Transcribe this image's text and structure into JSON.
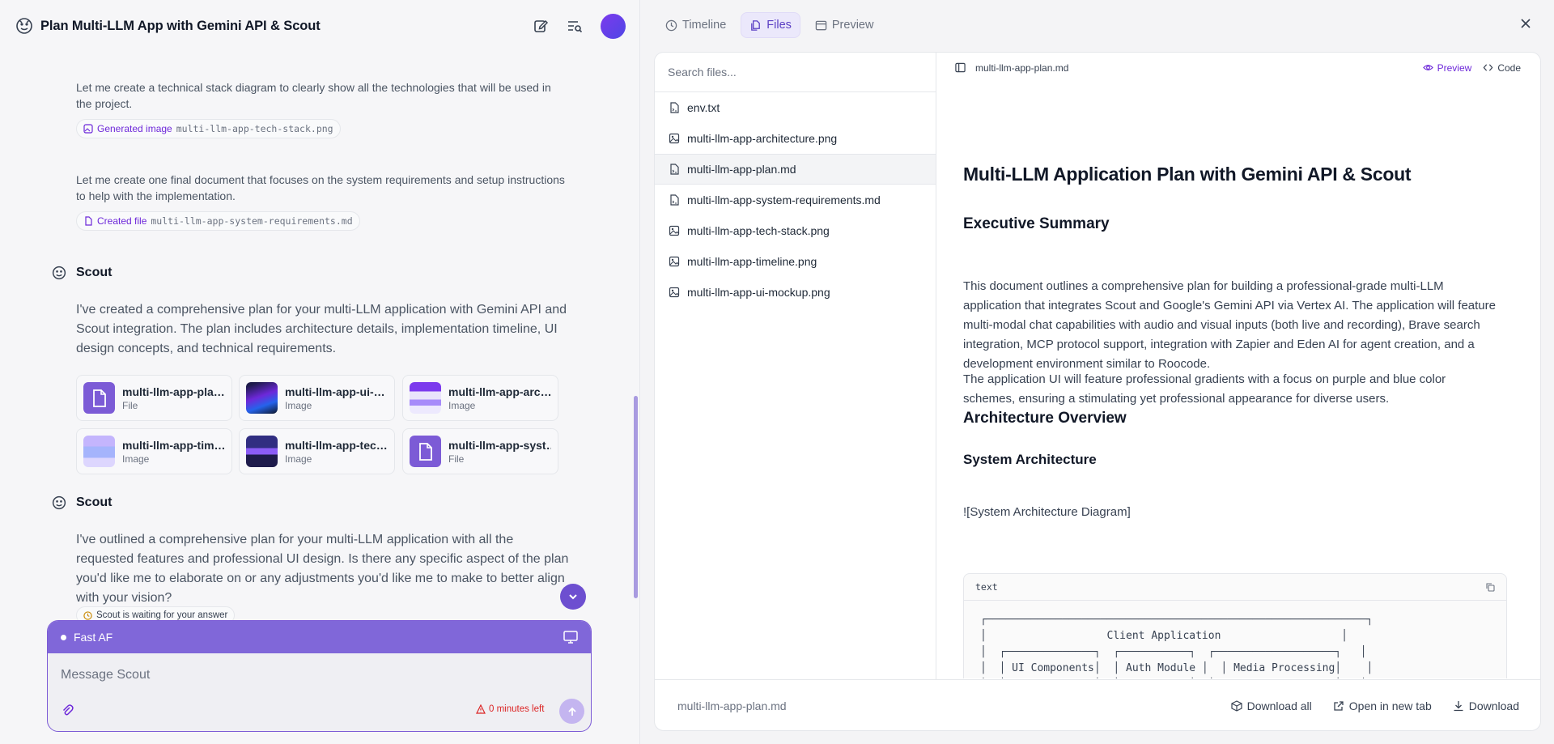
{
  "header": {
    "title": "Plan Multi-LLM App with Gemini API & Scout"
  },
  "chat": {
    "step1_text": "Let me create a technical stack diagram to clearly show all the technologies that will be used in the project.",
    "step1_chip_label": "Generated image",
    "step1_chip_file": "multi-llm-app-tech-stack.png",
    "step2_text": "Let me create one final document that focuses on the system requirements and setup instructions to help with the implementation.",
    "step2_chip_label": "Created file",
    "step2_chip_file": "multi-llm-app-system-requirements.md",
    "speaker1": "Scout",
    "msg1": "I've created a comprehensive plan for your multi-LLM application with Gemini API and Scout integration. The plan includes architecture details, implementation timeline, UI design concepts, and technical requirements.",
    "attachments": [
      {
        "name": "multi-llm-app-plan.md",
        "type": "File",
        "thumb": "file"
      },
      {
        "name": "multi-llm-app-ui-mockup.png",
        "type": "Image",
        "thumb": "img-a"
      },
      {
        "name": "multi-llm-app-architecture.png",
        "type": "Image",
        "thumb": "img-b"
      },
      {
        "name": "multi-llm-app-timeline.png",
        "type": "Image",
        "thumb": "img-c"
      },
      {
        "name": "multi-llm-app-tech-stack.png",
        "type": "Image",
        "thumb": "img-d"
      },
      {
        "name": "multi-llm-app-system-requirements.md",
        "type": "File",
        "thumb": "file"
      }
    ],
    "speaker2": "Scout",
    "msg2": "I've outlined a comprehensive plan for your multi-LLM application with all the requested features and professional UI design. Is there any specific aspect of the plan you'd like me to elaborate on or any adjustments you'd like me to make to better align with your vision?",
    "waiting": "Scout is waiting for your answer"
  },
  "composer": {
    "mode": "Fast AF",
    "placeholder": "Message Scout",
    "timer": "0 minutes left"
  },
  "tabs": [
    {
      "label": "Timeline",
      "icon": "clock-icon"
    },
    {
      "label": "Files",
      "icon": "files-icon"
    },
    {
      "label": "Preview",
      "icon": "browser-icon"
    }
  ],
  "files": {
    "search_placeholder": "Search files...",
    "items": [
      {
        "name": "env.txt",
        "icon": "doc-icon"
      },
      {
        "name": "multi-llm-app-architecture.png",
        "icon": "image-icon"
      },
      {
        "name": "multi-llm-app-plan.md",
        "icon": "doc-icon"
      },
      {
        "name": "multi-llm-app-system-requirements.md",
        "icon": "doc-icon"
      },
      {
        "name": "multi-llm-app-tech-stack.png",
        "icon": "image-icon"
      },
      {
        "name": "multi-llm-app-timeline.png",
        "icon": "image-icon"
      },
      {
        "name": "multi-llm-app-ui-mockup.png",
        "icon": "image-icon"
      }
    ],
    "selected": "multi-llm-app-plan.md"
  },
  "viewer": {
    "filename": "multi-llm-app-plan.md",
    "preview_label": "Preview",
    "code_label": "Code"
  },
  "doc": {
    "h1": "Multi-LLM Application Plan with Gemini API & Scout",
    "h2_exec": "Executive Summary",
    "p1": "This document outlines a comprehensive plan for building a professional-grade multi-LLM application that integrates Scout and Google's Gemini API via Vertex AI. The application will feature multi-modal chat capabilities with audio and visual inputs (both live and recording), Brave search integration, MCP protocol support, integration with Zapier and Eden AI for agent creation, and a development environment similar to Roocode.",
    "p2": "The application UI will feature professional gradients with a focus on purple and blue color schemes, ensuring a stimulating yet professional appearance for diverse users.",
    "h2_arch": "Architecture Overview",
    "h3_sys": "System Architecture",
    "img_md": "![System Architecture Diagram]",
    "code_lang": "text",
    "code": "┌────────────────────────────────────────────────────────────┐\n│                   Client Application                   │\n│  ┌──────────────┐  ┌───────────┐  ┌───────────────────┐   │\n│  │ UI Components│  │ Auth Module │  │ Media Processing│    │\n│  └──────────────┘  └───────────┘  └───────────────────┘   │\n└────────────┬─────────────────────────────────┬─────────────┘"
  },
  "footer": {
    "filename": "multi-llm-app-plan.md",
    "download_all": "Download all",
    "open_tab": "Open in new tab",
    "download": "Download"
  },
  "colors": {
    "accent": "#7c5bd6",
    "accent_dark": "#5b3fc4",
    "error": "#dc2626"
  }
}
